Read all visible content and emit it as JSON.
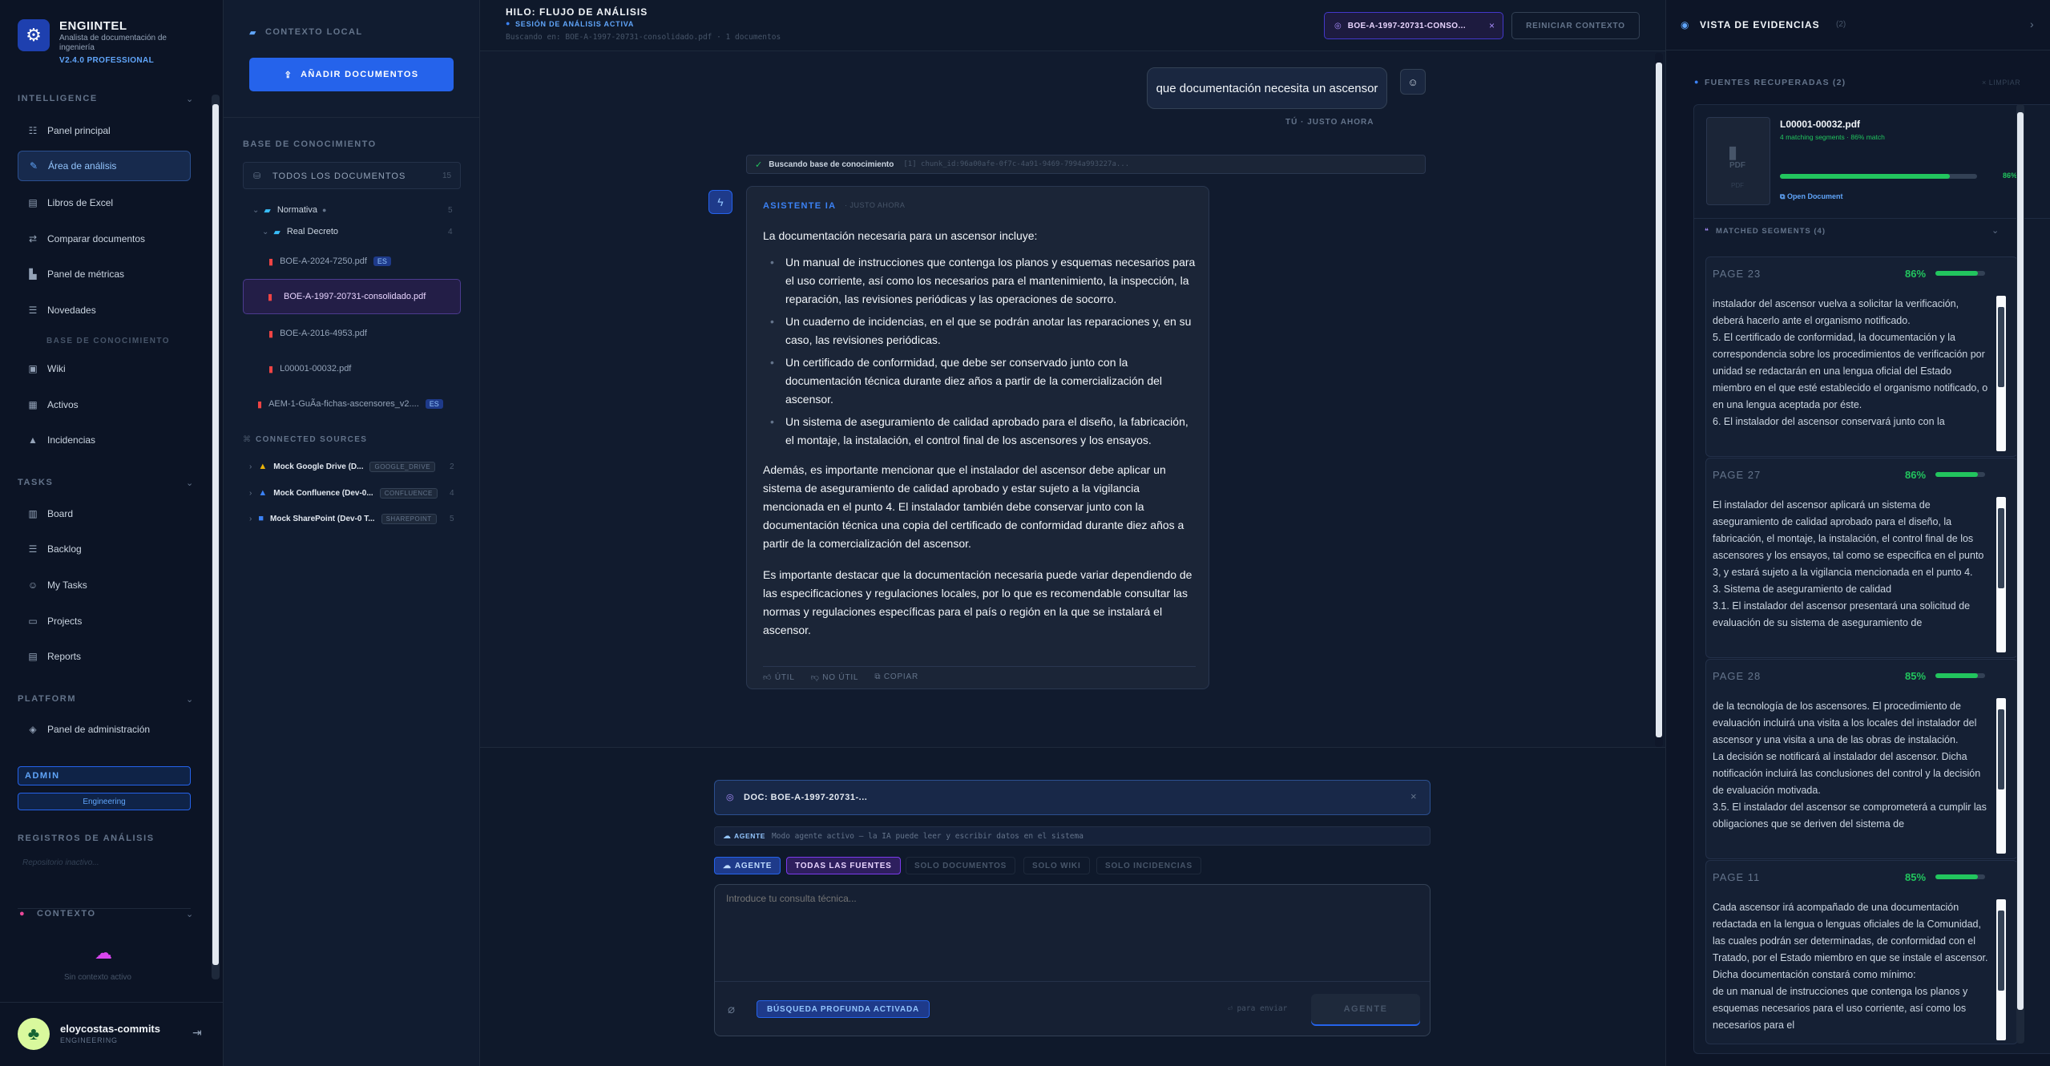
{
  "brand": {
    "name": "ENGIINTEL",
    "subtitle": "Analista de documentación de ingeniería",
    "version": "V2.4.0 PROFESSIONAL"
  },
  "sidebar": {
    "intelligence_title": "INTELLIGENCE",
    "items": [
      "Panel principal",
      "Área de análisis",
      "Libros de Excel",
      "Comparar documentos",
      "Panel de métricas",
      "Novedades"
    ],
    "kb_title": "BASE DE CONOCIMIENTO",
    "kb_items": [
      "Wiki",
      "Activos",
      "Incidencias"
    ],
    "tasks_title": "TASKS",
    "task_items": [
      "Board",
      "Backlog",
      "My Tasks",
      "Projects",
      "Reports"
    ],
    "platform_title": "PLATFORM",
    "platform_items": [
      "Panel de administración"
    ],
    "role": "ADMIN",
    "team": "Engineering",
    "logs_title": "REGISTROS DE ANÁLISIS",
    "logs_empty": "Repositorio inactivo...",
    "context_title": "CONTEXTO",
    "context_empty": "Sin contexto activo"
  },
  "user": {
    "name": "eloycostas-commits",
    "dept": "ENGINEERING"
  },
  "docpanel": {
    "local_title": "CONTEXTO LOCAL",
    "add_button": "AÑADIR DOCUMENTOS",
    "kb_title": "BASE DE CONOCIMIENTO",
    "all_docs": "TODOS LOS DOCUMENTOS",
    "all_count": "15",
    "folder1": "Normativa",
    "folder1_count": "5",
    "folder2": "Real Decreto",
    "folder2_count": "4",
    "files": [
      {
        "name": "BOE-A-2024-7250.pdf",
        "badge": "ES"
      },
      {
        "name": "BOE-A-1997-20731-consolidado.pdf"
      },
      {
        "name": "BOE-A-2016-4953.pdf"
      },
      {
        "name": "L00001-00032.pdf"
      },
      {
        "name": "AEM-1-GuÃa-fichas-ascensores_v2....",
        "badge": "ES"
      }
    ],
    "connected_title": "CONNECTED SOURCES",
    "sources": [
      {
        "name": "Mock Google Drive (D...",
        "badge": "GOOGLE_DRIVE",
        "count": "2"
      },
      {
        "name": "Mock Confluence (Dev-0...",
        "badge": "CONFLUENCE",
        "count": "4"
      },
      {
        "name": "Mock SharePoint (Dev-0 T...",
        "badge": "SHAREPOINT",
        "count": "5"
      }
    ]
  },
  "header": {
    "title": "HILO: FLUJO DE ANÁLISIS",
    "status": "SESIÓN DE ANÁLISIS ACTIVA",
    "search_info": "Buscando en: BOE-A-1997-20731-consolidado.pdf · 1 documentos",
    "doc_chip": "BOE-A-1997-20731-CONSO...",
    "reset": "REINICIAR CONTEXTO"
  },
  "chat": {
    "user_msg": "que documentación necesita un ascensor",
    "user_meta": "TÚ · JUSTO AHORA",
    "search_status": "Buscando base de conocimiento",
    "search_chunk": "[1] chunk_id:96a00afe-0f7c-4a91-9469-7994a993227a...",
    "ai_label": "ASISTENTE IA",
    "ai_time": "· JUSTO AHORA",
    "ai_intro": "La documentación necesaria para un ascensor incluye:",
    "ai_list": [
      "Un manual de instrucciones que contenga los planos y esquemas necesarios para el uso corriente, así como los necesarios para el mantenimiento, la inspección, la reparación, las revisiones periódicas y las operaciones de socorro.",
      "Un cuaderno de incidencias, en el que se podrán anotar las reparaciones y, en su caso, las revisiones periódicas.",
      "Un certificado de conformidad, que debe ser conservado junto con la documentación técnica durante diez años a partir de la comercialización del ascensor.",
      "Un sistema de aseguramiento de calidad aprobado para el diseño, la fabricación, el montaje, la instalación, el control final de los ascensores y los ensayos."
    ],
    "ai_p2": "Además, es importante mencionar que el instalador del ascensor debe aplicar un sistema de aseguramiento de calidad aprobado y estar sujeto a la vigilancia mencionada en el punto 4. El instalador también debe conservar junto con la documentación técnica una copia del certificado de conformidad durante diez años a partir de la comercialización del ascensor.",
    "ai_p3": "Es importante destacar que la documentación necesaria puede variar dependiendo de las especificaciones y regulaciones locales, por lo que es recomendable consultar las normas y regulaciones específicas para el país o región en la que se instalará el ascensor.",
    "useful": "ÚTIL",
    "not_useful": "NO ÚTIL",
    "copy": "COPIAR"
  },
  "composer": {
    "doc_ref": "DOC: BOE-A-1997-20731-...",
    "agent_tag": "AGENTE",
    "agent_msg": "Modo agente activo — la IA puede leer y escribir datos en el sistema",
    "filters": [
      "AGENTE",
      "TODAS LAS FUENTES",
      "SOLO DOCUMENTOS",
      "SOLO WIKI",
      "SOLO INCIDENCIAS"
    ],
    "placeholder": "Introduce tu consulta técnica...",
    "deep_search": "BÚSQUEDA PROFUNDA ACTIVADA",
    "send_hint": "⏎ para enviar",
    "send": "AGENTE"
  },
  "evidence": {
    "title": "VISTA DE EVIDENCIAS",
    "count": "(2)",
    "sources_title": "FUENTES RECUPERADAS (2)",
    "clear": "× LIMPIAR",
    "file": "L00001-00032.pdf",
    "file_meta": "4 matching segments · 86% match",
    "match_value": 0.86,
    "match_pct": "86%",
    "open": "Open Document",
    "pdf_label": "PDF",
    "segments_title": "MATCHED SEGMENTS (4)",
    "segments": [
      {
        "page": "PAGE 23",
        "pct": "86%",
        "value": 0.86,
        "text": "instalador del ascensor vuelva a solicitar la verificación, deberá hacerlo ante el organismo notificado.\n5. El certificado de conformidad, la documentación y la correspondencia sobre los procedimientos de verificación por unidad se redactarán en una lengua oficial del Estado miembro en el que esté establecido el organismo notificado, o en una lengua aceptada por éste.\n6. El instalador del ascensor conservará junto con la"
      },
      {
        "page": "PAGE 27",
        "pct": "86%",
        "value": 0.86,
        "text": "El instalador del ascensor aplicará un sistema de aseguramiento de calidad aprobado para el diseño, la fabricación, el montaje, la instalación, el control final de los ascensores y los ensayos, tal como se especifica en el punto 3, y estará sujeto a la vigilancia mencionada en el punto 4.\n3. Sistema de aseguramiento de calidad\n3.1. El instalador del ascensor presentará una solicitud de evaluación de su sistema de aseguramiento de"
      },
      {
        "page": "PAGE 28",
        "pct": "85%",
        "value": 0.85,
        "text": "de la tecnología de los ascensores. El procedimiento de evaluación incluirá una visita a los locales del instalador del ascensor y una visita a una de las obras de instalación.\nLa decisión se notificará al instalador del ascensor. Dicha notificación incluirá las conclusiones del control y la decisión de evaluación motivada.\n3.5. El instalador del ascensor se comprometerá a cumplir las obligaciones que se deriven del sistema de"
      },
      {
        "page": "PAGE 11",
        "pct": "85%",
        "value": 0.85,
        "text": "Cada ascensor irá acompañado de una documentación redactada en la lengua o lenguas oficiales de la Comunidad, las cuales podrán ser determinadas, de conformidad con el Tratado, por el Estado miembro en que se instale el ascensor. Dicha documentación constará como mínimo:\nde un manual de instrucciones que contenga los planos y esquemas necesarios para el uso corriente, así como los necesarios para el"
      }
    ]
  },
  "colors": {
    "accent": "#2563eb",
    "success": "#22c55e",
    "pdf": "#ef4444",
    "purple": "#a78bfa"
  }
}
